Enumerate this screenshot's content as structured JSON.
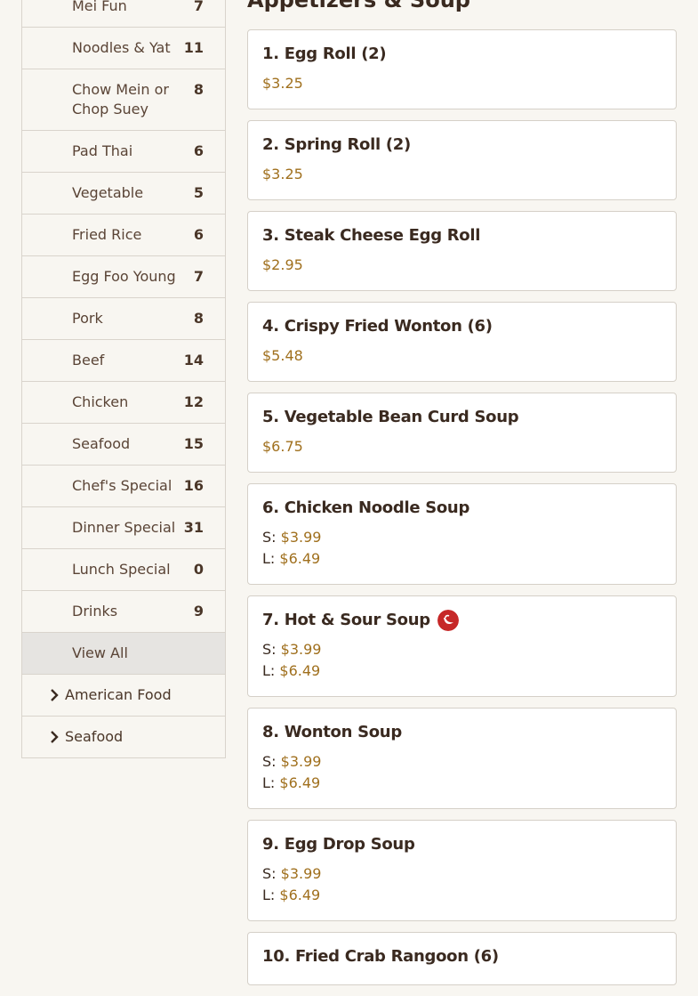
{
  "sidebar": {
    "categories": [
      {
        "label": "Mei Fun",
        "count": "7"
      },
      {
        "label": "Noodles & Yat",
        "count": "11"
      },
      {
        "label": "Chow Mein or Chop Suey",
        "count": "8"
      },
      {
        "label": "Pad Thai",
        "count": "6"
      },
      {
        "label": "Vegetable",
        "count": "5"
      },
      {
        "label": "Fried Rice",
        "count": "6"
      },
      {
        "label": "Egg Foo Young",
        "count": "7"
      },
      {
        "label": "Pork",
        "count": "8"
      },
      {
        "label": "Beef",
        "count": "14"
      },
      {
        "label": "Chicken",
        "count": "12"
      },
      {
        "label": "Seafood",
        "count": "15"
      },
      {
        "label": "Chef's Special",
        "count": "16"
      },
      {
        "label": "Dinner Special",
        "count": "31"
      },
      {
        "label": "Lunch Special",
        "count": "0"
      },
      {
        "label": "Drinks",
        "count": "9"
      }
    ],
    "view_all": "View All",
    "groups": [
      {
        "label": "American Food"
      },
      {
        "label": "Seafood"
      }
    ]
  },
  "main": {
    "section_title": "Appetizers & Soup",
    "size_small_prefix": "S:",
    "size_large_prefix": "L:",
    "items": [
      {
        "name": "1. Egg Roll (2)",
        "price": "$3.25"
      },
      {
        "name": "2. Spring Roll (2)",
        "price": "$3.25"
      },
      {
        "name": "3. Steak Cheese Egg Roll",
        "price": "$2.95"
      },
      {
        "name": "4. Crispy Fried Wonton (6)",
        "price": "$5.48"
      },
      {
        "name": "5. Vegetable Bean Curd Soup",
        "price": "$6.75"
      },
      {
        "name": "6. Chicken Noodle Soup",
        "small": "$3.99",
        "large": "$6.49"
      },
      {
        "name": "7. Hot & Sour Soup",
        "small": "$3.99",
        "large": "$6.49",
        "spicy": true
      },
      {
        "name": "8. Wonton Soup",
        "small": "$3.99",
        "large": "$6.49"
      },
      {
        "name": "9. Egg Drop Soup",
        "small": "$3.99",
        "large": "$6.49"
      },
      {
        "name": "10. Fried Crab Rangoon (6)"
      }
    ]
  },
  "colors": {
    "price": "#a0701e",
    "spicy_icon": "#c62828",
    "active_bg": "#e6e4e1"
  },
  "icons": {
    "group_expand": "chevron-right-icon",
    "spicy": "chili-pepper-icon"
  }
}
